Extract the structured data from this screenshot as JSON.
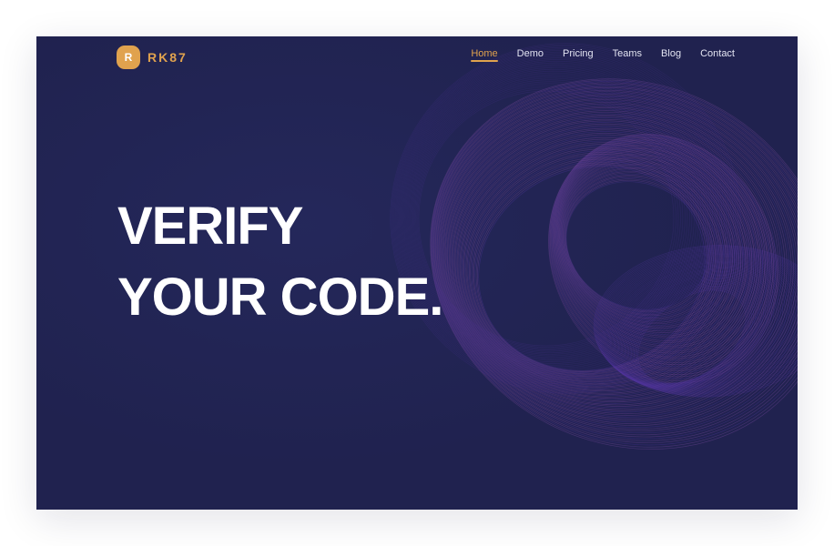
{
  "brand": {
    "badge_letter": "R",
    "name": "RK87",
    "accent_color": "#e0a24e"
  },
  "nav": {
    "items": [
      {
        "label": "Home",
        "active": true
      },
      {
        "label": "Demo",
        "active": false
      },
      {
        "label": "Pricing",
        "active": false
      },
      {
        "label": "Teams",
        "active": false
      },
      {
        "label": "Blog",
        "active": false
      },
      {
        "label": "Contact",
        "active": false
      }
    ]
  },
  "hero": {
    "line1": "VERIFY",
    "line2": "YOUR CODE."
  },
  "colors": {
    "background": "#20224f",
    "art_primary": "#8a4fb0",
    "art_secondary": "#5a3aa8"
  }
}
